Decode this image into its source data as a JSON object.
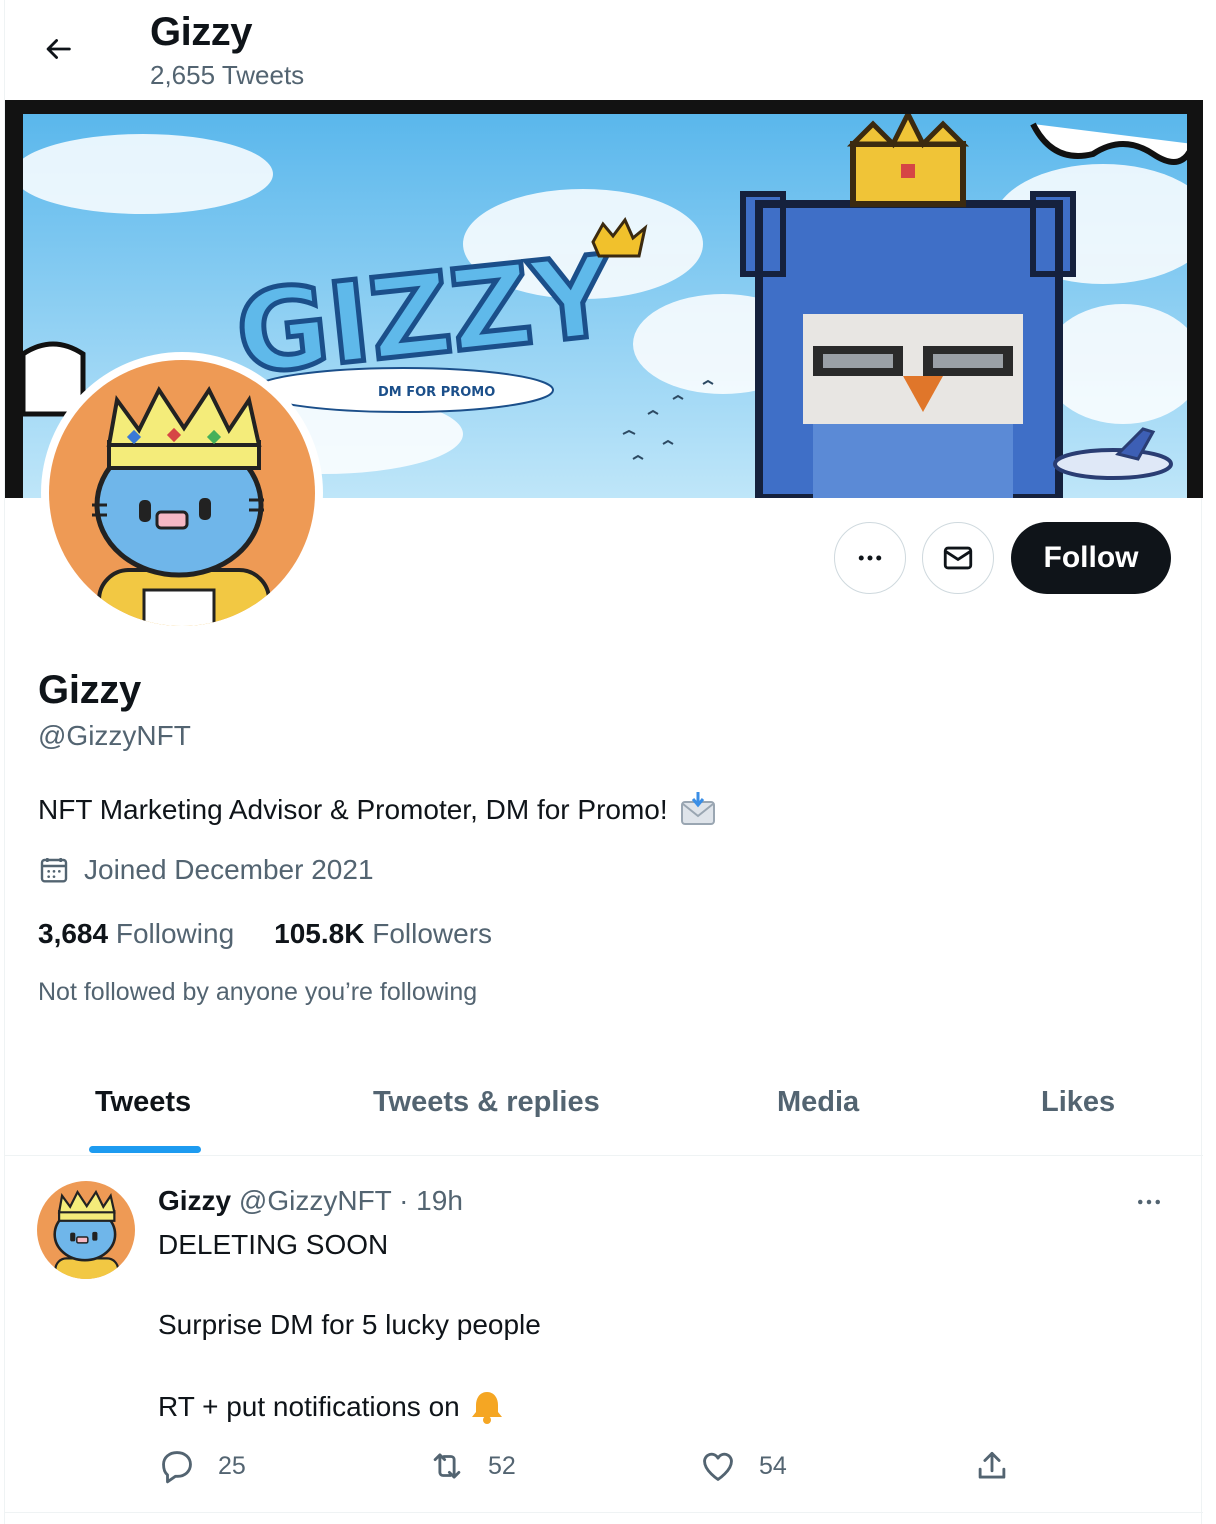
{
  "header": {
    "title": "Gizzy",
    "tweet_count": "2,655 Tweets"
  },
  "banner": {
    "logo_text": "GIZZY",
    "tagline": "DM FOR PROMO"
  },
  "actions": {
    "follow_label": "Follow"
  },
  "profile": {
    "name": "Gizzy",
    "handle": "@GizzyNFT",
    "bio": "NFT Marketing Advisor & Promoter, DM for Promo!",
    "joined": "Joined December 2021",
    "following_count": "3,684",
    "following_label": "Following",
    "followers_count": "105.8K",
    "followers_label": "Followers",
    "not_followed": "Not followed by anyone you’re following"
  },
  "tabs": [
    {
      "label": "Tweets",
      "active": true
    },
    {
      "label": "Tweets & replies",
      "active": false
    },
    {
      "label": "Media",
      "active": false
    },
    {
      "label": "Likes",
      "active": false
    }
  ],
  "tweet": {
    "name": "Gizzy",
    "handle": "@GizzyNFT",
    "separator": "·",
    "time": "19h",
    "lines": [
      "DELETING SOON",
      "Surprise DM for 5 lucky people",
      "RT + put notifications on"
    ],
    "replies": "25",
    "retweets": "52",
    "likes": "54"
  },
  "colors": {
    "accent": "#1d9bf0",
    "text": "#0f1419",
    "muted": "#536471",
    "border": "#cfd9de",
    "avatar_bg": "#ee9a55"
  },
  "icons": [
    "back-arrow-icon",
    "more-icon",
    "mail-icon",
    "calendar-icon",
    "incoming-envelope-emoji",
    "bell-emoji",
    "reply-icon",
    "retweet-icon",
    "like-icon",
    "share-icon"
  ]
}
